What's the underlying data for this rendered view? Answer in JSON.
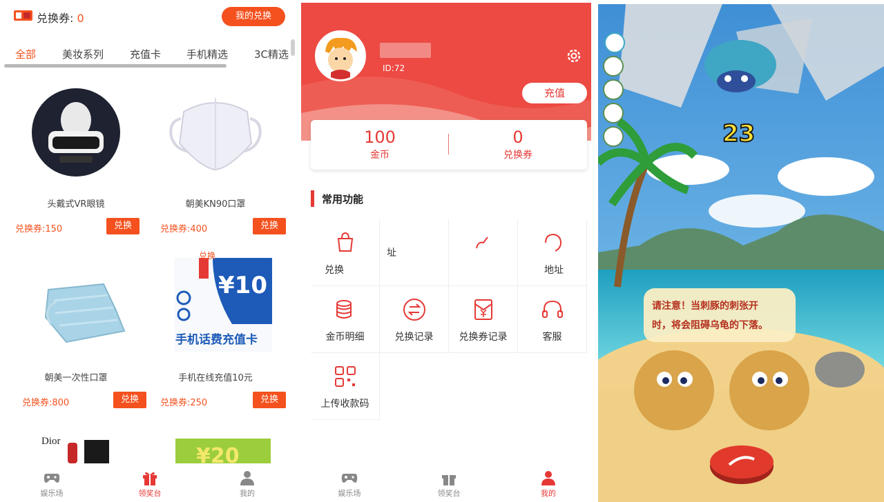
{
  "shop": {
    "coupon_label": "兑换券:",
    "coupon_count": "0",
    "my_exchange_label": "我的兑换",
    "tabs": [
      "全部",
      "美妆系列",
      "充值卡",
      "手机精选",
      "3C精选"
    ],
    "products": [
      {
        "name": "头戴式VR眼镜",
        "price": "兑换券:150",
        "button": "兑换"
      },
      {
        "name": "朝美KN90口罩",
        "price": "兑换券:400",
        "button": "兑换"
      },
      {
        "name": "朝美一次性口罩",
        "price": "兑换券:800",
        "button": "兑换"
      },
      {
        "name": "手机在线充值10元",
        "price": "兑换券:250",
        "button": "兑换"
      }
    ],
    "recharge_card_text": "手机话费充值卡",
    "recharge_card_amount": "¥10",
    "overlap_exchange": "兑换",
    "dior_text": "Dior",
    "partial_amount": "¥20",
    "nav": [
      "娱乐场",
      "领奖台",
      "我的"
    ],
    "nav_active": 1
  },
  "profile": {
    "user_id": "ID:72",
    "recharge_label": "充值",
    "gold_value": "100",
    "gold_label": "金币",
    "coupon_value": "0",
    "coupon_label": "兑换券",
    "section_title": "常用功能",
    "functions": [
      "兑换",
      "址",
      "",
      "",
      "地址",
      "金币明细",
      "兑换记录",
      "兑换券记录",
      "客服",
      "上传收款码"
    ],
    "nav": [
      "娱乐场",
      "领奖台",
      "我的"
    ],
    "nav_active": 2
  },
  "game": {
    "score": "23",
    "tip_line1": "请注意！当刺豚的刺张开",
    "tip_line2": "时，将会阻碍乌龟的下落。"
  },
  "colors": {
    "accent": "#f4511e",
    "profile_red": "#e53935",
    "sea": "#2fb3c9",
    "sand": "#f2d28b"
  }
}
